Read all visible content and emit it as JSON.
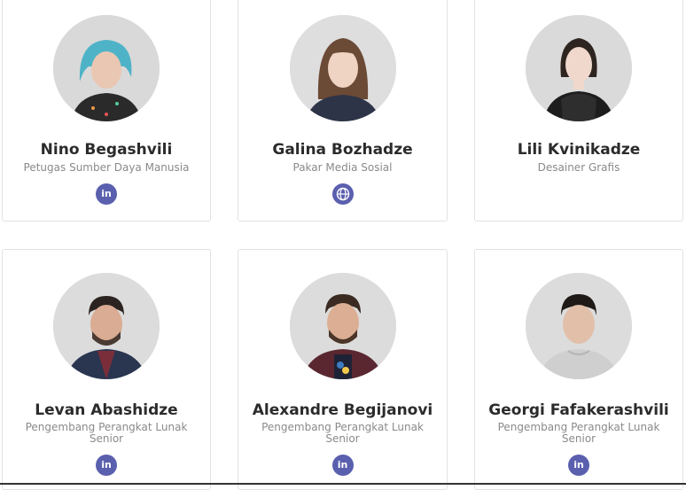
{
  "accent_color": "#5a5fae",
  "team": [
    {
      "name": "Nino Begashvili",
      "role": "Petugas Sumber Daya Manusia",
      "social_icon": "linkedin-icon",
      "social_label": "in"
    },
    {
      "name": "Galina Bozhadze",
      "role": "Pakar Media Sosial",
      "social_icon": "globe-icon",
      "social_label": ""
    },
    {
      "name": "Lili Kvinikadze",
      "role": "Desainer Grafis",
      "social_icon": "",
      "social_label": ""
    },
    {
      "name": "Levan Abashidze",
      "role": "Pengembang Perangkat Lunak Senior",
      "social_icon": "linkedin-icon",
      "social_label": "in"
    },
    {
      "name": "Alexandre Begijanovi",
      "role": "Pengembang Perangkat Lunak Senior",
      "social_icon": "linkedin-icon",
      "social_label": "in"
    },
    {
      "name": "Georgi Fafakerashvili",
      "role": "Pengembang Perangkat Lunak Senior",
      "social_icon": "linkedin-icon",
      "social_label": "in"
    }
  ]
}
